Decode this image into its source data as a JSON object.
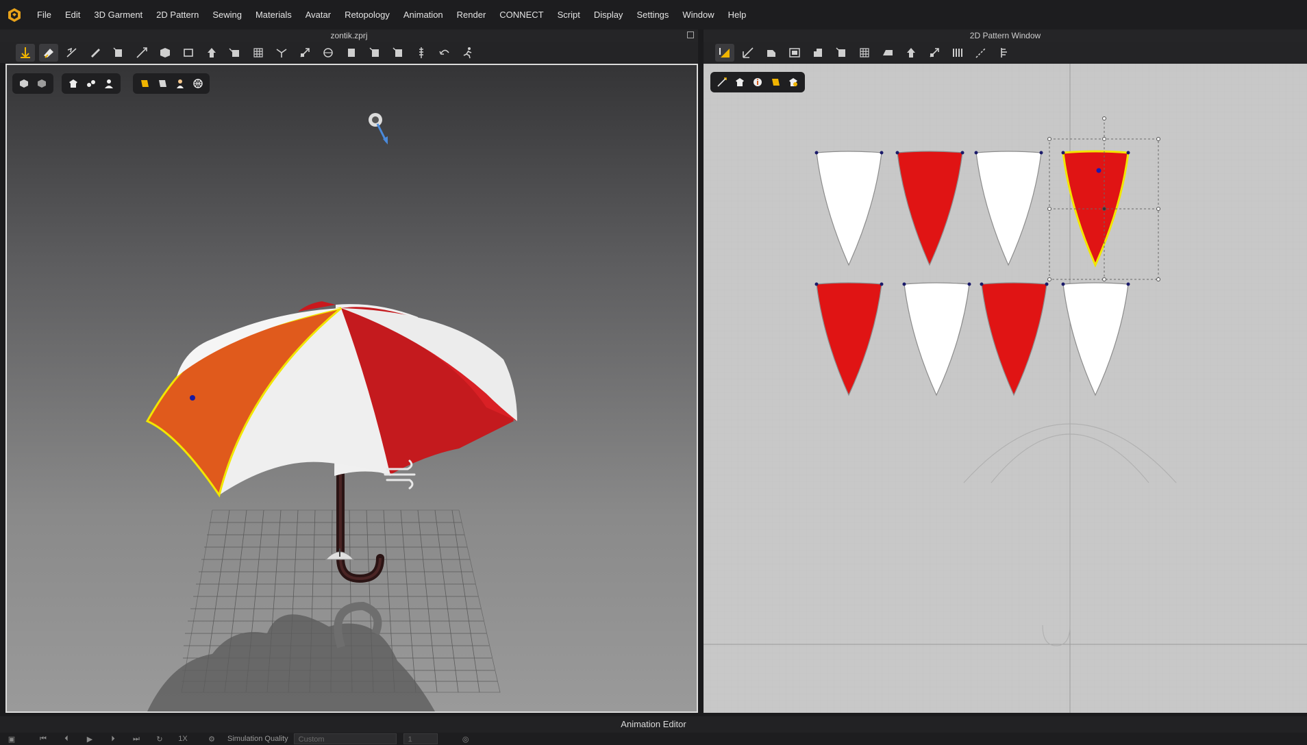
{
  "menu": {
    "items": [
      "File",
      "Edit",
      "3D Garment",
      "2D Pattern",
      "Sewing",
      "Materials",
      "Avatar",
      "Retopology",
      "Animation",
      "Render",
      "CONNECT",
      "Script",
      "Display",
      "Settings",
      "Window",
      "Help"
    ]
  },
  "left_panel": {
    "title": "zontik.zprj"
  },
  "right_panel": {
    "title": "2D Pattern Window"
  },
  "bottom_panel": {
    "title": "Animation Editor"
  },
  "animation_bar": {
    "speed_label": "1X",
    "sim_quality_label": "Simulation Quality",
    "sim_quality_value": "Custom",
    "frame_value": "1"
  },
  "colors": {
    "accent": "#f0b400",
    "selection_outline": "#f2e600",
    "pattern_red": "#e01414",
    "pattern_white": "#ffffff",
    "umbrella_orange": "#e05a1c",
    "umbrella_red": "#c9181d"
  },
  "patterns": {
    "row1": [
      "white",
      "red",
      "white",
      "red-selected"
    ],
    "row2": [
      "red",
      "white",
      "red",
      "white"
    ]
  },
  "icons": {
    "left_toolbar": [
      "select-move-icon",
      "select-mesh-icon",
      "fold-arrange-icon",
      "transform-icon",
      "pin-icon",
      "measure-icon",
      "arrange-icon",
      "flatten-icon",
      "avatar-icon",
      "tape-icon",
      "grid-icon",
      "steam-icon",
      "pin-box-icon",
      "iron-icon",
      "trim-icon",
      "button-icon",
      "buttonhole-icon",
      "zipper-icon",
      "pleat-icon",
      "run-icon"
    ],
    "right_toolbar": [
      "transform-pattern-icon",
      "edit-pattern-icon",
      "rectangle-icon",
      "internal-rect-icon",
      "trace-icon",
      "dart-icon",
      "grid-pattern-icon",
      "fold-icon",
      "arrange-pattern-icon",
      "sew-segment-icon",
      "free-sew-icon",
      "line-icon",
      "ruler-icon"
    ]
  }
}
